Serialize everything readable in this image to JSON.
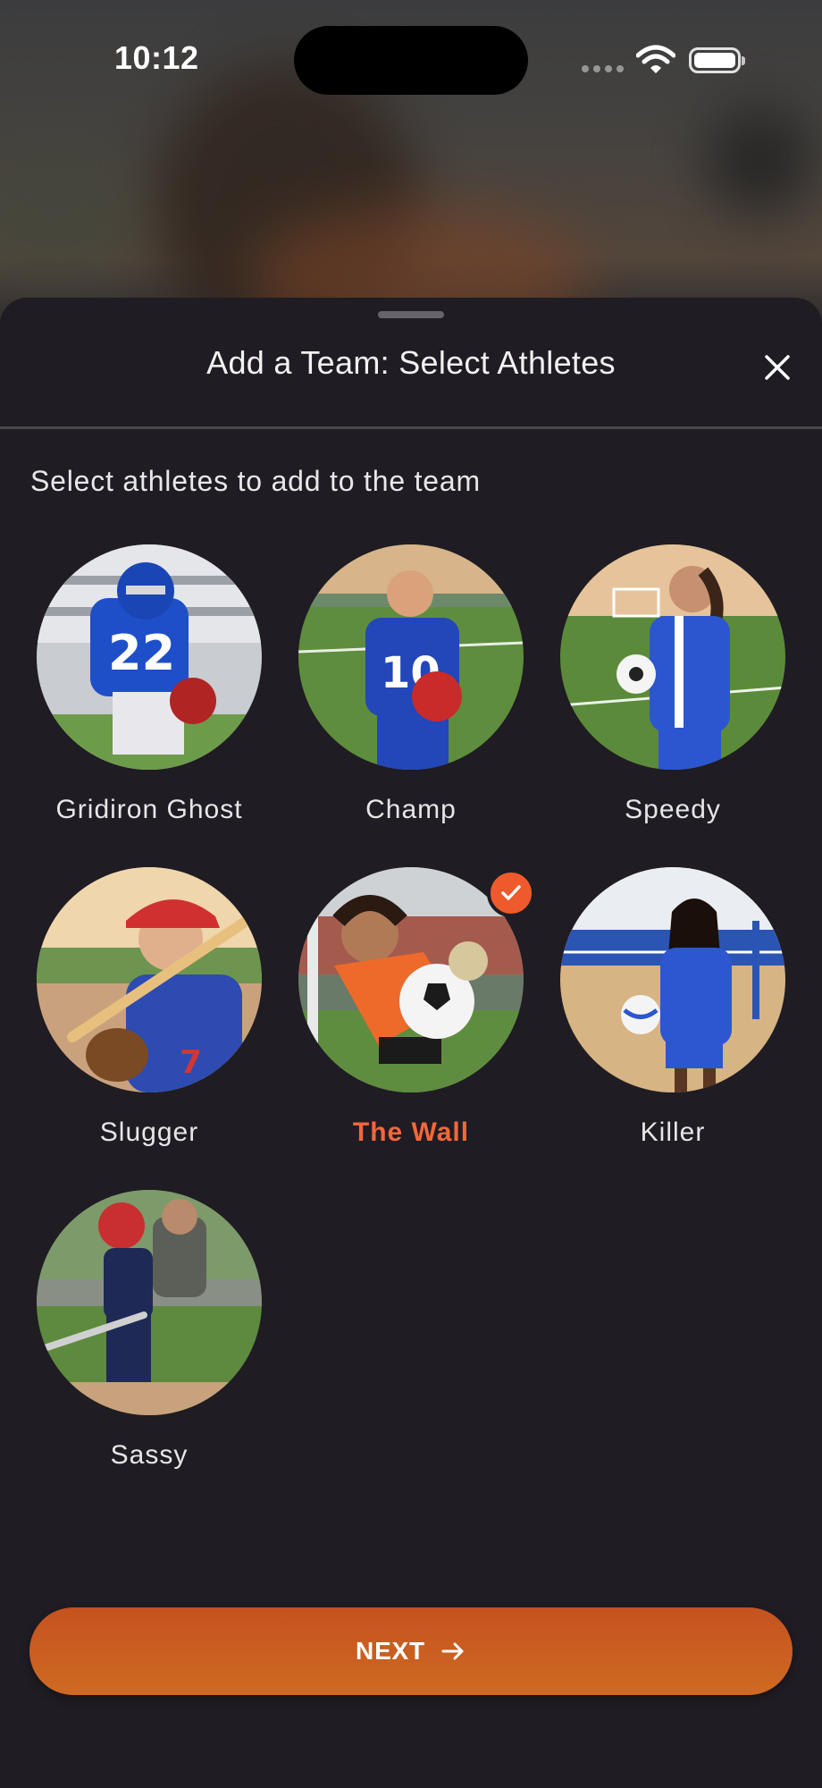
{
  "status_bar": {
    "time": "10:12"
  },
  "sheet": {
    "title": "Add a Team: Select Athletes",
    "subtitle": "Select athletes to add to the team"
  },
  "athletes": [
    {
      "name": "Gridiron Ghost",
      "selected": false
    },
    {
      "name": "Champ",
      "selected": false
    },
    {
      "name": "Speedy",
      "selected": false
    },
    {
      "name": "Slugger",
      "selected": false
    },
    {
      "name": "The Wall",
      "selected": true
    },
    {
      "name": "Killer",
      "selected": false
    },
    {
      "name": "Sassy",
      "selected": false
    }
  ],
  "next_button": {
    "label": "NEXT"
  },
  "colors": {
    "accent": "#ee5a2c",
    "sheet_bg": "#1f1c23",
    "button_gradient_top": "#c5521f",
    "button_gradient_bottom": "#cf6a22"
  },
  "icons": {
    "close": "close-icon",
    "next": "arrow-right-icon",
    "selected": "checkmark-icon",
    "wifi": "wifi-icon",
    "battery": "battery-icon"
  }
}
